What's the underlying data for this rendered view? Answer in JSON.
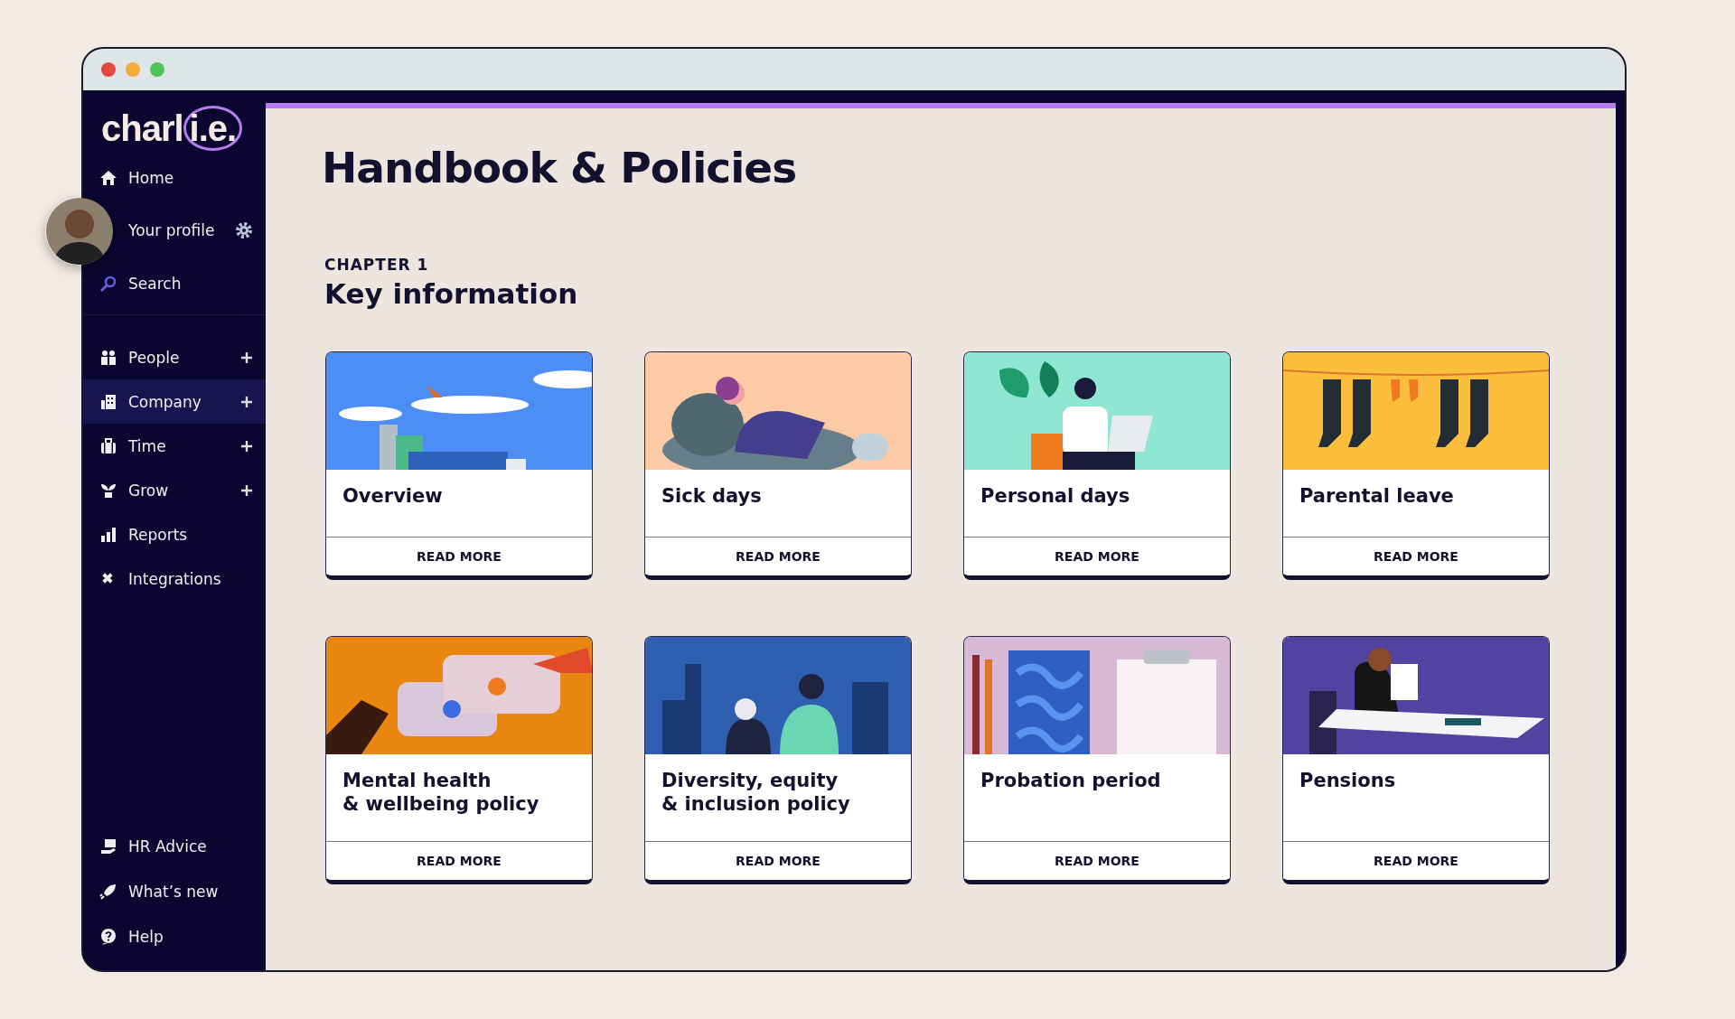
{
  "logo": {
    "text": "charl",
    "accent": "i.e."
  },
  "sidebar": {
    "top_items": [
      {
        "kind": "home",
        "label": "Home",
        "expandable": false,
        "selected": false
      },
      {
        "kind": "profile",
        "label": "Your profile",
        "expandable": false,
        "selected": false
      },
      {
        "kind": "search",
        "label": "Search",
        "expandable": false,
        "selected": false
      }
    ],
    "items": [
      {
        "kind": "people",
        "label": "People",
        "expandable": true,
        "selected": false
      },
      {
        "kind": "company",
        "label": "Company",
        "expandable": true,
        "selected": true
      },
      {
        "kind": "time",
        "label": "Time",
        "expandable": true,
        "selected": false
      },
      {
        "kind": "grow",
        "label": "Grow",
        "expandable": true,
        "selected": false
      },
      {
        "kind": "reports",
        "label": "Reports",
        "expandable": false,
        "selected": false
      },
      {
        "kind": "integrations",
        "label": "Integrations",
        "expandable": false,
        "selected": false
      }
    ],
    "bottom_items": [
      {
        "kind": "advice",
        "label": "HR Advice",
        "expandable": false,
        "selected": false
      },
      {
        "kind": "rocket",
        "label": "What’s new",
        "expandable": false,
        "selected": false
      },
      {
        "kind": "help",
        "label": "Help",
        "expandable": false,
        "selected": false
      }
    ]
  },
  "page": {
    "title": "Handbook & Policies",
    "chapter": "CHAPTER 1",
    "section": "Key information"
  },
  "cards": [
    {
      "title": "Overview",
      "button": "READ MORE"
    },
    {
      "title": "Sick days",
      "button": "READ MORE"
    },
    {
      "title": "Personal days",
      "button": "READ MORE"
    },
    {
      "title": "Parental leave",
      "button": "READ MORE"
    },
    {
      "title": "Mental health\n& wellbeing policy",
      "button": "READ MORE"
    },
    {
      "title": "Diversity, equity\n& inclusion policy",
      "button": "READ MORE"
    },
    {
      "title": "Probation period",
      "button": "READ MORE"
    },
    {
      "title": "Pensions",
      "button": "READ MORE"
    }
  ]
}
